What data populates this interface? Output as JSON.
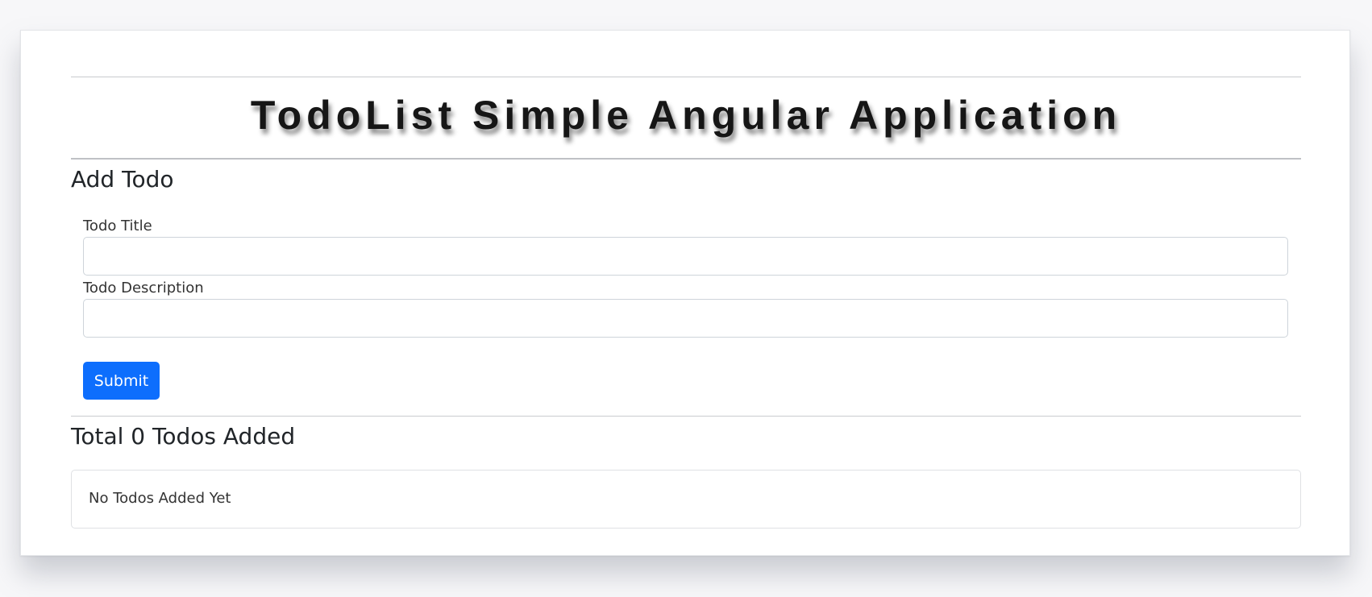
{
  "header": {
    "title": "TodoList Simple Angular Application"
  },
  "add_form": {
    "heading": "Add Todo",
    "title_label": "Todo Title",
    "title_value": "",
    "description_label": "Todo Description",
    "description_value": "",
    "submit_label": "Submit"
  },
  "todo_list": {
    "heading": "Total 0 Todos Added",
    "count": 0,
    "empty_message": "No Todos Added Yet"
  },
  "colors": {
    "accent": "#0d6efd",
    "background": "#f7f7f9",
    "card": "#ffffff",
    "text": "#212529"
  }
}
